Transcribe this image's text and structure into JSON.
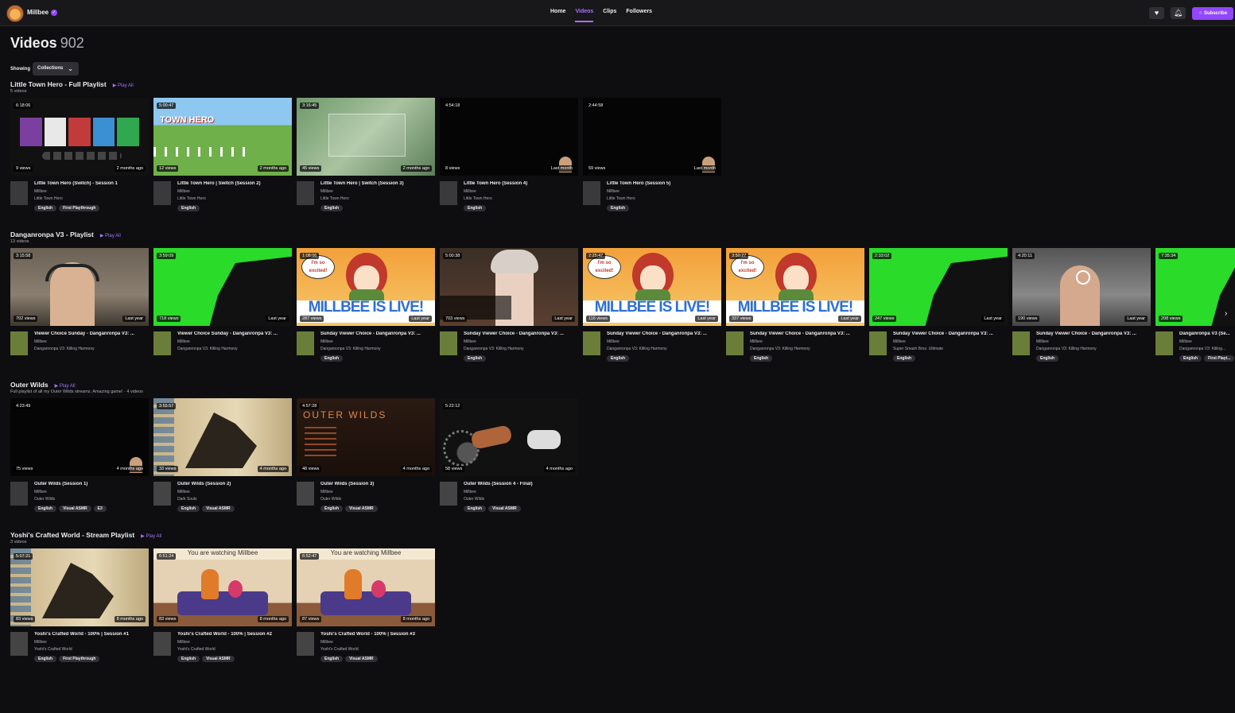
{
  "header": {
    "channel": "Millbee",
    "verified_icon": "check-icon",
    "tabs": [
      {
        "label": "Home",
        "active": false
      },
      {
        "label": "Videos",
        "active": true
      },
      {
        "label": "Clips",
        "active": false
      },
      {
        "label": "Followers",
        "active": false
      }
    ],
    "follow_icon": "heart-icon",
    "notify_icon": "bell-icon",
    "subscribe_label": "Subscribe",
    "accent": "#9147ff"
  },
  "page": {
    "title": "Videos",
    "count": "902"
  },
  "filter": {
    "label": "Showing",
    "value": "Collections"
  },
  "sections": [
    {
      "title": "Little Town Hero - Full Playlist",
      "play_all": "Play All",
      "subtitle": "5 videos",
      "videos": [
        {
          "duration": "6:18:06",
          "views": "9 views",
          "age": "2 months ago",
          "title": "Little Town Hero (Switch) - Session 1",
          "channel": "Millbee",
          "game": "Little Town Hero",
          "tags": [
            "English",
            "First Playthrough"
          ],
          "thumb": "menu"
        },
        {
          "duration": "5:00:47",
          "views": "12 views",
          "age": "2 months ago",
          "title": "Little Town Hero | Switch (Session 2)",
          "channel": "Millbee",
          "game": "Little Town Hero",
          "tags": [
            "English"
          ],
          "thumb": "town"
        },
        {
          "duration": "3:16:45",
          "views": "45 views",
          "age": "2 months ago",
          "title": "Little Town Hero | Switch (Session 3)",
          "channel": "Millbee",
          "game": "Little Town Hero",
          "tags": [
            "English"
          ],
          "thumb": "blur"
        },
        {
          "duration": "4:54:18",
          "views": "8 views",
          "age": "Last month",
          "title": "Little Town Hero (Session 4)",
          "channel": "Millbee",
          "game": "Little Town Hero",
          "tags": [
            "English"
          ],
          "thumb": "dark"
        },
        {
          "duration": "2:44:58",
          "views": "59 views",
          "age": "Last month",
          "title": "Little Town Hero (Session 5)",
          "channel": "Millbee",
          "game": "Little Town Hero",
          "tags": [
            "English"
          ],
          "thumb": "dark"
        }
      ]
    },
    {
      "title": "Danganronpa V3 - Playlist",
      "play_all": "Play All",
      "subtitle": "13 videos",
      "videos": [
        {
          "duration": "3:15:58",
          "views": "702 views",
          "age": "Last year",
          "title": "Viewer Choice Sunday - Danganronpa V3: ...",
          "channel": "Millbee",
          "game": "Danganronpa V3: Killing Harmony",
          "tags": [],
          "thumb": "cam"
        },
        {
          "duration": "3:59:09",
          "views": "718 views",
          "age": "Last year",
          "title": "Viewer Choice Sunday - Danganronpa V3: ...",
          "channel": "Millbee",
          "game": "Danganronpa V3: Killing Harmony",
          "tags": [],
          "thumb": "green"
        },
        {
          "duration": "1:08:06",
          "views": "287 views",
          "age": "Last year",
          "title": "Sunday Viewer Choice - Danganronpa V3: ...",
          "channel": "Millbee",
          "game": "Danganronpa V3: Killing Harmony",
          "tags": [
            "English"
          ],
          "thumb": "live"
        },
        {
          "duration": "5:00:38",
          "views": "703 views",
          "age": "Last year",
          "title": "Sunday Viewer Choice - Danganronpa V3: ...",
          "channel": "Millbee",
          "game": "Danganronpa V3: Killing Harmony",
          "tags": [
            "English"
          ],
          "thumb": "anime"
        },
        {
          "duration": "2:25:47",
          "views": "116 views",
          "age": "Last year",
          "title": "Sunday Viewer Choice - Danganronpa V3: ...",
          "channel": "Millbee",
          "game": "Danganronpa V3: Killing Harmony",
          "tags": [
            "English"
          ],
          "thumb": "live"
        },
        {
          "duration": "3:50:27",
          "views": "337 views",
          "age": "Last year",
          "title": "Sunday Viewer Choice - Danganronpa V3: ...",
          "channel": "Millbee",
          "game": "Danganronpa V3: Killing Harmony",
          "tags": [
            "English"
          ],
          "thumb": "live"
        },
        {
          "duration": "2:33:02",
          "views": "247 views",
          "age": "Last year",
          "title": "Sunday Viewer Choice - Danganronpa V3: ...",
          "channel": "Millbee",
          "game": "Super Smash Bros. Ultimate",
          "tags": [
            "English"
          ],
          "thumb": "green"
        },
        {
          "duration": "4:20:11",
          "views": "190 views",
          "age": "Last year",
          "title": "Sunday Viewer Choice - Danganronpa V3: ...",
          "channel": "Millbee",
          "game": "Danganronpa V3: Killing Harmony",
          "tags": [
            "English"
          ],
          "thumb": "cam2"
        },
        {
          "duration": "7:35:34",
          "views": "208 views",
          "age": "",
          "title": "Danganronpa V3 (Se...",
          "channel": "Millbee",
          "game": "Danganronpa V3: Killing...",
          "tags": [
            "English",
            "First Playt..."
          ],
          "thumb": "green"
        }
      ]
    },
    {
      "title": "Outer Wilds",
      "play_all": "Play All",
      "subtitle": "Full playlist of all my Outer Wilds streams. Amazing game! · 4 videos",
      "videos": [
        {
          "duration": "4:23:49",
          "views": "75 views",
          "age": "4 months ago",
          "title": "Outer Wilds (Session 1)",
          "channel": "Millbee",
          "game": "Outer Wilds",
          "tags": [
            "English",
            "Visual ASMR",
            "E3"
          ],
          "thumb": "dark"
        },
        {
          "duration": "3:55:57",
          "views": "33 views",
          "age": "4 months ago",
          "title": "Outer Wilds (Session 2)",
          "channel": "Millbee",
          "game": "Dark Souls",
          "tags": [
            "English",
            "Visual ASMR"
          ],
          "thumb": "sepia"
        },
        {
          "duration": "4:57:28",
          "views": "48 views",
          "age": "4 months ago",
          "title": "Outer Wilds (Session 3)",
          "channel": "Millbee",
          "game": "Outer Wilds",
          "tags": [
            "English",
            "Visual ASMR"
          ],
          "thumb": "wilds"
        },
        {
          "duration": "5:22:12",
          "views": "58 views",
          "age": "4 months ago",
          "title": "Outer Wilds (Session 4 - Final)",
          "channel": "Millbee",
          "game": "Outer Wilds",
          "tags": [
            "English",
            "Visual ASMR"
          ],
          "thumb": "space"
        }
      ]
    },
    {
      "title": "Yoshi's Crafted World - Stream Playlist",
      "play_all": "Play All",
      "subtitle": "3 videos",
      "videos": [
        {
          "duration": "5:07:21",
          "views": "83 views",
          "age": "8 months ago",
          "title": "Yoshi's Crafted World - 100% | Session #1",
          "channel": "Millbee",
          "game": "Yoshi's Crafted World",
          "tags": [
            "English",
            "First Playthrough"
          ],
          "thumb": "sepia"
        },
        {
          "duration": "6:51:24",
          "views": "83 views",
          "age": "8 months ago",
          "title": "Yoshi's Crafted World - 100% | Session #2",
          "channel": "Millbee",
          "game": "Yoshi's Crafted World",
          "tags": [
            "English",
            "Visual ASMR"
          ],
          "thumb": "room"
        },
        {
          "duration": "6:52:47",
          "views": "87 views",
          "age": "8 months ago",
          "title": "Yoshi's Crafted World - 100% | Session #3",
          "channel": "Millbee",
          "game": "Yoshi's Crafted World",
          "tags": [
            "English",
            "Visual ASMR"
          ],
          "thumb": "room"
        }
      ]
    }
  ],
  "thumb_texts": {
    "live": "MILLBEE IS LIVE!",
    "excited": "I'm so excited!",
    "room": "You are watching Millbee",
    "wilds": "OUTER WILDS",
    "town": "TOWN HERO"
  }
}
